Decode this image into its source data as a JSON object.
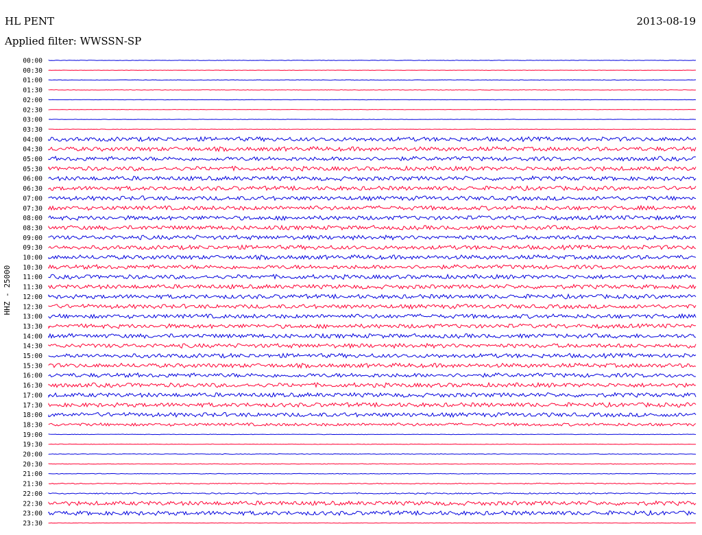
{
  "header": {
    "station": "HL PENT",
    "date": "2013-08-19",
    "filter": "Applied filter: WWSSN-SP"
  },
  "chart_data": {
    "type": "line",
    "title": "HL PENT",
    "subtitle": "Applied filter: WWSSN-SP",
    "ylabel": "HHZ - 25000",
    "xlabel": "",
    "rows": [
      "00:00",
      "00:30",
      "01:00",
      "01:30",
      "02:00",
      "02:30",
      "03:00",
      "03:30",
      "04:00",
      "04:30",
      "05:00",
      "05:30",
      "06:00",
      "06:30",
      "07:00",
      "07:30",
      "08:00",
      "08:30",
      "09:00",
      "09:30",
      "10:00",
      "10:30",
      "11:00",
      "11:30",
      "12:00",
      "12:30",
      "13:00",
      "13:30",
      "14:00",
      "14:30",
      "15:00",
      "15:30",
      "16:00",
      "16:30",
      "17:00",
      "17:30",
      "18:00",
      "18:30",
      "19:00",
      "19:30",
      "20:00",
      "20:30",
      "21:00",
      "21:30",
      "22:00",
      "22:30",
      "23:00",
      "23:30"
    ],
    "colors": [
      "#0000dd",
      "#ff0033"
    ],
    "noise_level": [
      0.3,
      0.3,
      0.4,
      0.4,
      0.3,
      0.3,
      0.3,
      0.4,
      3.5,
      3.5,
      3.5,
      3.5,
      3.5,
      3.5,
      3.5,
      3.5,
      3.5,
      3.5,
      3.5,
      3.5,
      3.5,
      3.5,
      3.5,
      3.5,
      3.5,
      3.5,
      3.5,
      3.5,
      3.5,
      3.5,
      3.5,
      3.5,
      3.5,
      3.5,
      3.5,
      3.5,
      3.5,
      2.5,
      0.4,
      0.4,
      0.5,
      0.5,
      0.5,
      0.8,
      1.0,
      3.5,
      3.5,
      0.3
    ],
    "grid": false,
    "legend": "none"
  }
}
